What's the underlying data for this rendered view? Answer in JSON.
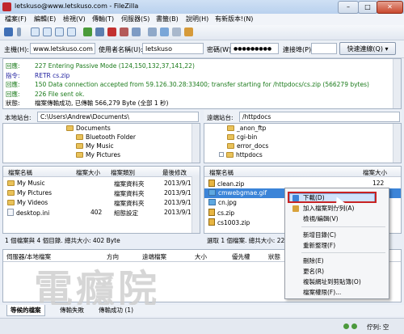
{
  "window": {
    "title": "letskuso@www.letskuso.com - FileZilla",
    "minimize": "–",
    "maximize": "□",
    "close": "✕"
  },
  "menu": [
    "檔案(F)",
    "編輯(E)",
    "檢視(V)",
    "傳輸(T)",
    "伺服器(S)",
    "書籤(B)",
    "說明(H)",
    "有新版本!(N)"
  ],
  "quickconnect": {
    "host_label": "主機(H):",
    "host_value": "www.letskuso.com",
    "user_label": "使用者名稱(U):",
    "user_value": "letskuso",
    "pass_label": "密碼(W):",
    "pass_value": "●●●●●●●●●",
    "port_label": "連接埠(P):",
    "port_value": "",
    "button": "快速連線(Q)",
    "dropdown": "▾"
  },
  "log": [
    {
      "label": "回應:",
      "text": "227 Entering Passive Mode (124,150,132,37,141,22)",
      "color": "#1a7a1a"
    },
    {
      "label": "指令:",
      "text": "RETR cs.zip",
      "color": "#1a1a9c"
    },
    {
      "label": "回應:",
      "text": "150 Data connection accepted from 59.126.30.28:33400; transfer starting for /httpdocs/cs.zip (566279 bytes)",
      "color": "#1a7a1a"
    },
    {
      "label": "回應:",
      "text": "226 File sent ok.",
      "color": "#1a7a1a"
    },
    {
      "label": "狀態:",
      "text": "檔案傳輸成功, 已傳輸 566,279 Byte (全部 1 秒)",
      "color": "#000000"
    }
  ],
  "local": {
    "site_label": "本地站台:",
    "site_value": "C:\\Users\\Andrew\\Documents\\",
    "tree": [
      "Documents",
      "Bluetooth Folder",
      "My Music",
      "My Pictures"
    ],
    "headers": [
      "檔案名稱",
      "檔案大小",
      "檔案類別",
      "最後修改"
    ],
    "files": [
      {
        "name": "My Music",
        "size": "",
        "type": "檔案資料夾",
        "date": "2013/9/14"
      },
      {
        "name": "My Pictures",
        "size": "",
        "type": "檔案資料夾",
        "date": "2013/9/14"
      },
      {
        "name": "My Videos",
        "size": "",
        "type": "檔案資料夾",
        "date": "2013/9/14"
      },
      {
        "name": "desktop.ini",
        "size": "402",
        "type": "組態設定",
        "date": "2013/9/14"
      }
    ],
    "status": "1 個檔案與 4 個目錄. 總共大小: 402 Byte"
  },
  "remote": {
    "site_label": "遠端站台:",
    "site_value": "/httpdocs",
    "tree": [
      "_anon_ftp",
      "cgi-bin",
      "error_docs",
      "httpdocs"
    ],
    "headers": [
      "檔案名稱",
      "檔案大小"
    ],
    "files": [
      {
        "name": "clean.zip",
        "size": "122"
      },
      {
        "name": "cmwebgmae.gif",
        "size": ""
      },
      {
        "name": "cn.jpg",
        "size": ""
      },
      {
        "name": "cs.zip",
        "size": ""
      },
      {
        "name": "cs1003.zip",
        "size": ""
      }
    ],
    "status": "選取 1 個檔案. 總共大小: 22,74"
  },
  "context_menu": {
    "items": [
      "下載(D)",
      "加入檔案到佇列(A)",
      "檢視/編輯(V)",
      "新增目錄(C)",
      "重新整理(F)",
      "刪除(E)",
      "更名(R)",
      "複製網址到剪貼簿(O)",
      "檔案權限(F)..."
    ]
  },
  "queue": {
    "headers": [
      "伺服器/本地檔案",
      "方向",
      "遠端檔案",
      "大小",
      "優先權",
      "狀態"
    ]
  },
  "tabs": [
    "等候的檔案",
    "傳輸失敗",
    "傳輸成功 (1)"
  ],
  "statusbar": {
    "queue": "佇列: 空"
  },
  "watermark": "電癮院",
  "colors": {
    "accent": "#3b84d8",
    "highlight": "#c82323"
  }
}
